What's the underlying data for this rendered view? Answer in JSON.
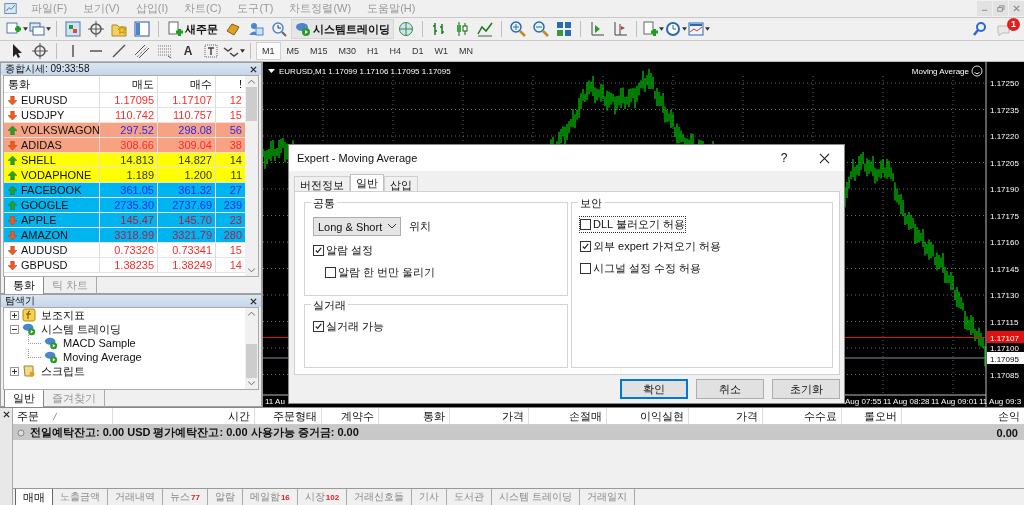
{
  "menu": [
    "파일(F)",
    "보기(V)",
    "삽입(I)",
    "차트(C)",
    "도구(T)",
    "차트정렬(W)",
    "도움말(H)"
  ],
  "toolbar": {
    "new_order": "새주문",
    "system_trading": "시스템트레이딩",
    "notifications": "1"
  },
  "drawing_toolbar": {
    "text_tool": "A",
    "timeframes": [
      {
        "label": "M1",
        "selected": true
      },
      {
        "label": "M5",
        "selected": false
      },
      {
        "label": "M15",
        "selected": false
      },
      {
        "label": "M30",
        "selected": false
      },
      {
        "label": "H1",
        "selected": false
      },
      {
        "label": "H4",
        "selected": false
      },
      {
        "label": "D1",
        "selected": false
      },
      {
        "label": "W1",
        "selected": false
      },
      {
        "label": "MN",
        "selected": false
      }
    ]
  },
  "market_watch": {
    "title": "종합시세: 09:33:58",
    "columns": [
      "통화",
      "매도",
      "매수",
      "!"
    ],
    "rows": [
      {
        "symbol": "EURUSD",
        "bid": "1.17095",
        "ask": "1.17107",
        "spread": "12",
        "rising": false,
        "color": "#ffffff"
      },
      {
        "symbol": "USDJPY",
        "bid": "110.742",
        "ask": "110.757",
        "spread": "15",
        "rising": false,
        "color": "#ffffff"
      },
      {
        "symbol": "VOLKSWAGON",
        "bid": "297.52",
        "ask": "298.08",
        "spread": "56",
        "rising": true,
        "color": "#f7a383"
      },
      {
        "symbol": "ADIDAS",
        "bid": "308.66",
        "ask": "309.04",
        "spread": "38",
        "rising": false,
        "color": "#f7a383"
      },
      {
        "symbol": "SHELL",
        "bid": "14.813",
        "ask": "14.827",
        "spread": "14",
        "rising": true,
        "color": "#ffff00"
      },
      {
        "symbol": "VODAPHONE",
        "bid": "1.189",
        "ask": "1.200",
        "spread": "11",
        "rising": true,
        "color": "#ffff00"
      },
      {
        "symbol": "FACEBOOK",
        "bid": "361.05",
        "ask": "361.32",
        "spread": "27",
        "rising": true,
        "color": "#00b4f0"
      },
      {
        "symbol": "GOOGLE",
        "bid": "2735.30",
        "ask": "2737.69",
        "spread": "239",
        "rising": true,
        "color": "#00b4f0"
      },
      {
        "symbol": "APPLE",
        "bid": "145.47",
        "ask": "145.70",
        "spread": "23",
        "rising": false,
        "color": "#00b4f0"
      },
      {
        "symbol": "AMAZON",
        "bid": "3318.99",
        "ask": "3321.79",
        "spread": "280",
        "rising": false,
        "color": "#00b4f0"
      },
      {
        "symbol": "AUDUSD",
        "bid": "0.73326",
        "ask": "0.73341",
        "spread": "15",
        "rising": false,
        "color": "#ffffff"
      },
      {
        "symbol": "GBPUSD",
        "bid": "1.38235",
        "ask": "1.38249",
        "spread": "14",
        "rising": false,
        "color": "#ffffff"
      }
    ],
    "tabs": [
      {
        "label": "통화",
        "selected": true
      },
      {
        "label": "틱 차트",
        "selected": false
      }
    ]
  },
  "navigator": {
    "title": "탐색기",
    "tree": [
      {
        "label": "보조지표",
        "kind": "indicators",
        "expanded": false
      },
      {
        "label": "시스템 트레이딩",
        "kind": "experts",
        "expanded": true,
        "children": [
          {
            "label": "MACD Sample",
            "kind": "expert"
          },
          {
            "label": "Moving Average",
            "kind": "expert"
          }
        ]
      },
      {
        "label": "스크립트",
        "kind": "scripts",
        "expanded": false
      }
    ],
    "tabs": [
      {
        "label": "일반",
        "selected": true
      },
      {
        "label": "즐겨찾기",
        "selected": false
      }
    ]
  },
  "chart": {
    "header": "EURUSD,M1  1.17099 1.17106 1.17095 1.17095",
    "expert": "Moving Average",
    "price_labels": [
      "1.17250",
      "1.17235",
      "1.17220",
      "1.17205",
      "1.17190",
      "1.17175",
      "1.17160",
      "1.17145",
      "1.17130",
      "1.17115",
      "1.17100",
      "1.17085"
    ],
    "ask_marker": "1.17107",
    "bid_marker": "1.17095",
    "time_labels": [
      "11 Au",
      "Aug 07:55",
      "11 Aug 08:28",
      "11 Aug 09:01",
      "11 Aug 09:3"
    ]
  },
  "dialog": {
    "title": "Expert - Moving Average",
    "help": "?",
    "tabs": [
      {
        "label": "버전정보",
        "selected": false
      },
      {
        "label": "일반",
        "selected": true
      },
      {
        "label": "삽입",
        "selected": false
      }
    ],
    "common": {
      "title": "공통",
      "position_select": "Long & Short",
      "position_label": "위치",
      "options": [
        {
          "label": "알람 설정",
          "checked": true,
          "children": [
            {
              "label": "알람 한 번만 울리기",
              "checked": false
            }
          ]
        }
      ]
    },
    "live": {
      "title": "실거래",
      "options": [
        {
          "label": "실거래 가능",
          "checked": true
        }
      ]
    },
    "security": {
      "title": "보안",
      "options": [
        {
          "label": "DLL 불러오기 허용",
          "checked": false,
          "focused": true
        },
        {
          "label": "외부 expert 가져오기 허용",
          "checked": true,
          "focused": false
        },
        {
          "label": "시그널 설정 수정 허용",
          "checked": false,
          "focused": false
        }
      ]
    },
    "buttons": [
      {
        "label": "확인",
        "default": true
      },
      {
        "label": "취소",
        "default": false
      },
      {
        "label": "초기화",
        "default": false
      }
    ]
  },
  "terminal": {
    "columns": [
      "주문",
      "시간",
      "주문형태",
      "계약수",
      "통화",
      "가격",
      "손절매",
      "이익실현",
      "가격",
      "수수료",
      "롤오버",
      "손익"
    ],
    "summary": "전일예탁잔고: 0.00 USD  평가예탁잔고: 0.00  사용가능 증거금: 0.00",
    "profit": "0.00",
    "tabs": [
      {
        "label": "매매",
        "selected": true
      },
      {
        "label": "노출금액",
        "selected": false
      },
      {
        "label": "거래내역",
        "selected": false
      },
      {
        "label": "뉴스",
        "count": "77",
        "selected": false
      },
      {
        "label": "알람",
        "selected": false
      },
      {
        "label": "메일함",
        "count": "16",
        "selected": false
      },
      {
        "label": "시장",
        "count": "102",
        "selected": false
      },
      {
        "label": "거래신호들",
        "selected": false
      },
      {
        "label": "기사",
        "selected": false
      },
      {
        "label": "도서관",
        "selected": false
      },
      {
        "label": "시스템 트레이딩",
        "selected": false
      },
      {
        "label": "거래일지",
        "selected": false
      }
    ]
  }
}
